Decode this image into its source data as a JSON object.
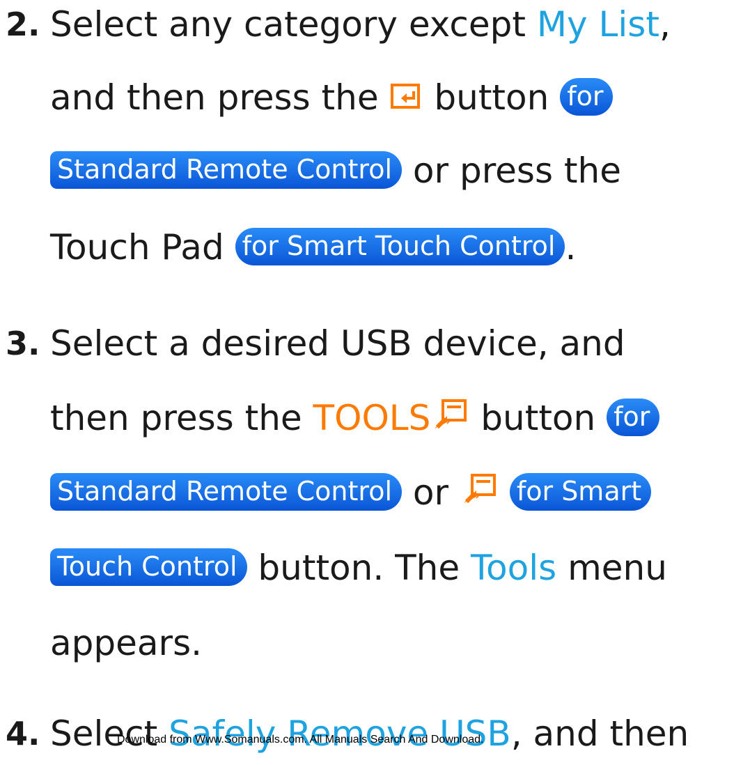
{
  "steps": [
    {
      "number": "2.",
      "lines": [
        {
          "pre": "Select any category except ",
          "link": "My List",
          "post": ","
        },
        {
          "pre": "and then press the ",
          "icon": "enter-icon",
          "mid": " button ",
          "pill": "for"
        },
        {
          "pill": "Standard Remote Control",
          "post": " or press the"
        },
        {
          "pre": "Touch Pad ",
          "pill": "for Smart Touch Control",
          "post": "."
        }
      ]
    },
    {
      "number": "3.",
      "lines": [
        {
          "pre": "Select a desired USB device, and"
        },
        {
          "pre": "then press the ",
          "link": "TOOLS",
          "icon": "tools-icon",
          "mid": " button ",
          "pill": "for"
        },
        {
          "pill": "Standard Remote Control",
          "mid": " or ",
          "icon": "tools-icon",
          "pill2": "for Smart"
        },
        {
          "pill": "Touch Control",
          "mid": " button. The ",
          "link": "Tools",
          "post": " menu"
        },
        {
          "pre": "appears."
        }
      ]
    },
    {
      "number": "4.",
      "lines": [
        {
          "pre": "Select ",
          "link": "Safely Remove USB",
          "post": ", and then"
        }
      ]
    }
  ],
  "footer": "Download from Www.Somanuals.com. All Manuals Search And Download.",
  "colors": {
    "link": "#1ea3e0",
    "tools": "#ff7a00",
    "pill": "#1a6fe8"
  }
}
